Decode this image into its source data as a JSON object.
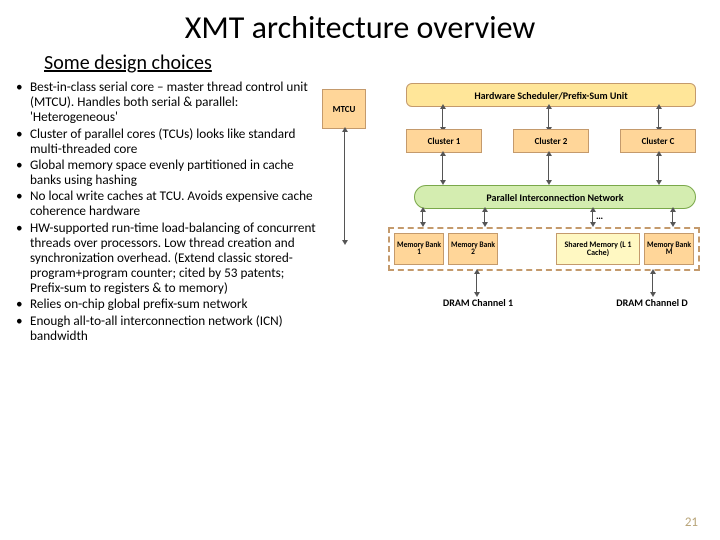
{
  "title": "XMT architecture overview",
  "subtitle": "Some design choices",
  "bullets": [
    "Best-in-class serial core – master thread control unit (MTCU). Handles both serial & parallel: 'Heterogeneous'",
    "Cluster of parallel cores (TCUs) looks like standard multi-threaded core",
    "Global memory space evenly partitioned in cache banks using hashing",
    "No local write caches at TCU. Avoids expensive cache coherence hardware",
    "HW-supported run-time load-balancing of concurrent threads over processors. Low thread creation and synchronization overhead. (Extend classic stored-program+program counter; cited by 53 patents; Prefix-sum to registers & to memory)",
    "Relies on-chip global prefix-sum network",
    "Enough all-to-all interconnection network (ICN) bandwidth"
  ],
  "diagram": {
    "mtcu": "MTCU",
    "scheduler": "Hardware Scheduler/Prefix-Sum Unit",
    "clusters": [
      "Cluster 1",
      "Cluster 2",
      "Cluster C"
    ],
    "icn": "Parallel Interconnection Network",
    "dots": "…",
    "membanks": [
      "Memory\nBank 1",
      "Memory\nBank 2"
    ],
    "l1": "Shared Memory\n(L 1 Cache)",
    "membankM": "Memory\nBank M",
    "dram1": "DRAM Channel\n1",
    "dramD": "DRAM Channel\nD"
  },
  "page_number": "21"
}
